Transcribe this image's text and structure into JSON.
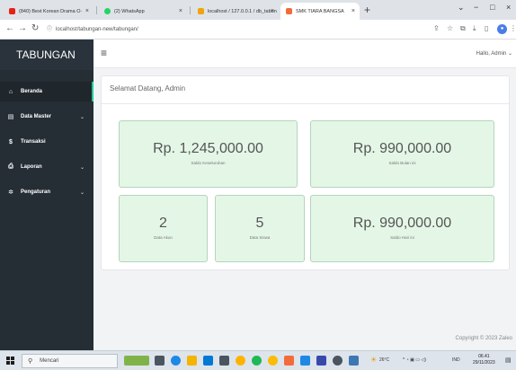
{
  "browser": {
    "tabs": [
      {
        "title": "(840) Best Korean Drama O·"
      },
      {
        "title": "(2) WhatsApp"
      },
      {
        "title": "localhost / 127.0.0.1 / db_tabun"
      },
      {
        "title": "SMK TIARA BANGSA"
      }
    ],
    "url": "localhost/tabungan-new/tabungan/"
  },
  "sidebar": {
    "brand": "TABUNGAN",
    "items": [
      {
        "label": "Beranda"
      },
      {
        "label": "Data Master"
      },
      {
        "label": "Transaksi"
      },
      {
        "label": "Laporan"
      },
      {
        "label": "Pengaturan"
      }
    ]
  },
  "topbar": {
    "greeting": "Hallo, Admin"
  },
  "main": {
    "welcome": "Selamat Datang, Admin",
    "stats": {
      "saldo_keseluruhan": {
        "value": "Rp. 1,245,000.00",
        "label": "Saldo Keseluruhan"
      },
      "saldo_bulan_ini": {
        "value": "Rp. 990,000.00",
        "label": "Saldo Bulan ini"
      },
      "data_akun": {
        "value": "2",
        "label": "Data Akun"
      },
      "data_siswa": {
        "value": "5",
        "label": "Data Siswa"
      },
      "saldo_hari_ini": {
        "value": "Rp. 990,000.00",
        "label": "Saldo Hari ini"
      }
    }
  },
  "footer": {
    "copyright": "Copyright © 2023 Zaleo"
  },
  "taskbar": {
    "search_placeholder": "Mencari",
    "weather": "26°C",
    "lang": "IND",
    "time": "06.41",
    "date": "29/11/2023"
  },
  "colors": {
    "sidebar": "#252d35",
    "accent": "#20c997",
    "stat_bg": "#e4f7e7",
    "stat_border": "#b5d4bb"
  }
}
